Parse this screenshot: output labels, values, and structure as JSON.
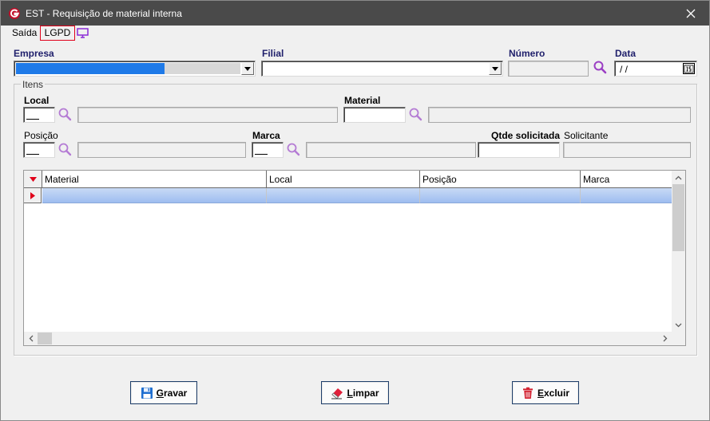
{
  "window": {
    "title": "EST - Requisição de material interna"
  },
  "menu": {
    "saida": "Saída",
    "lgpd": "LGPD"
  },
  "header": {
    "empresa_label": "Empresa",
    "filial_label": "Filial",
    "numero_label": "Número",
    "data_label": "Data",
    "data_value": " / /"
  },
  "itens": {
    "group_title": "Itens",
    "local_label": "Local",
    "material_label": "Material",
    "posicao_label": "Posição",
    "marca_label": "Marca",
    "qtde_label": "Qtde solicitada",
    "solicitante_label": "Solicitante"
  },
  "grid": {
    "columns": [
      "Material",
      "Local",
      "Posição",
      "Marca"
    ]
  },
  "buttons": {
    "gravar": {
      "first": "G",
      "rest": "ravar"
    },
    "limpar": {
      "first": "L",
      "rest": "impar"
    },
    "excluir": {
      "first": "E",
      "rest": "xcluir"
    }
  },
  "colors": {
    "accent_red": "#e0001a",
    "search_icon": "#a64cc4",
    "selected_row": "#9ebdf0",
    "titlebar": "#4a4a4a",
    "empresa_highlight": "#1f7ae8"
  },
  "icons": {
    "app": "app-logo-icon",
    "close": "close-icon",
    "monitor": "monitor-icon",
    "search": "search-icon",
    "calendar": "calendar-icon",
    "save": "floppy-disk-icon",
    "eraser": "eraser-icon",
    "delete": "trash-icon"
  }
}
